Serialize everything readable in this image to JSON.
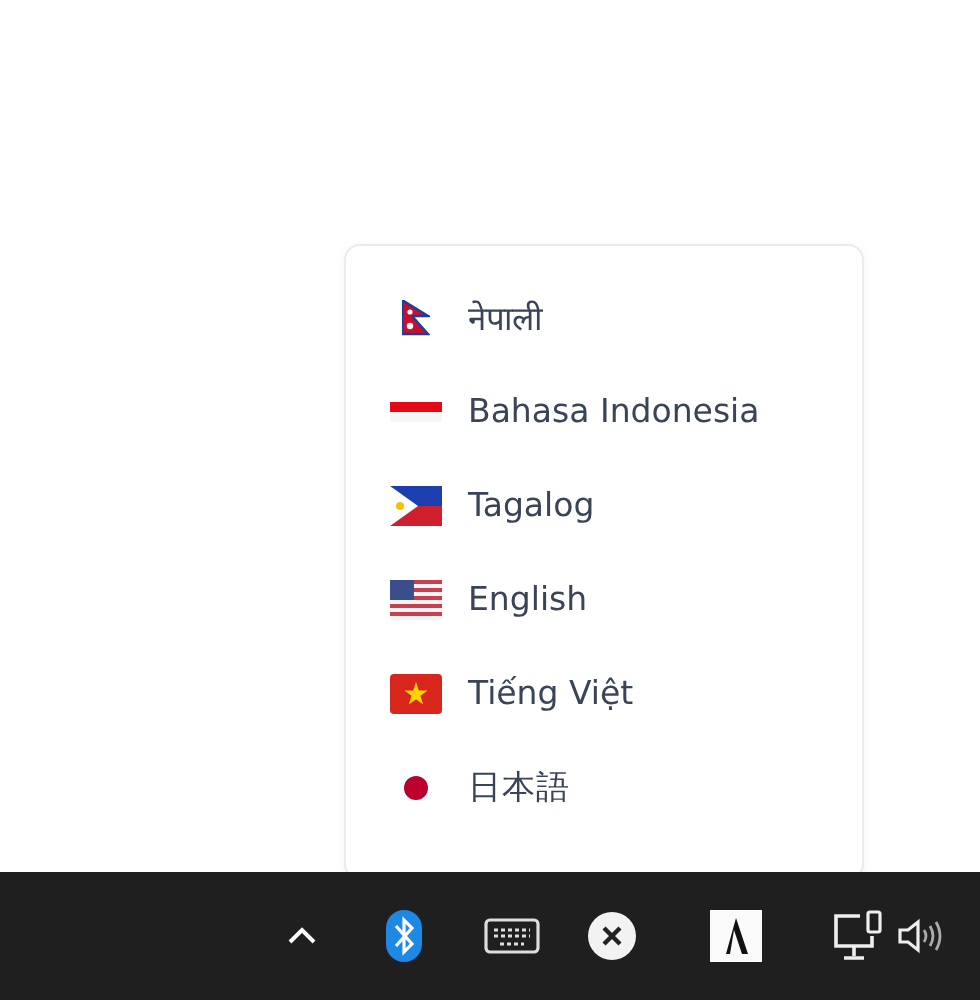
{
  "language_menu": {
    "items": [
      {
        "label": "नेपाली",
        "kind": "nepal"
      },
      {
        "label": "Bahasa Indonesia",
        "kind": "indonesia"
      },
      {
        "label": "Tagalog",
        "kind": "philippines"
      },
      {
        "label": "English",
        "kind": "usa"
      },
      {
        "label": "Tiếng Việt",
        "kind": "vietnam"
      },
      {
        "label": "日本語",
        "kind": "japan"
      }
    ]
  }
}
